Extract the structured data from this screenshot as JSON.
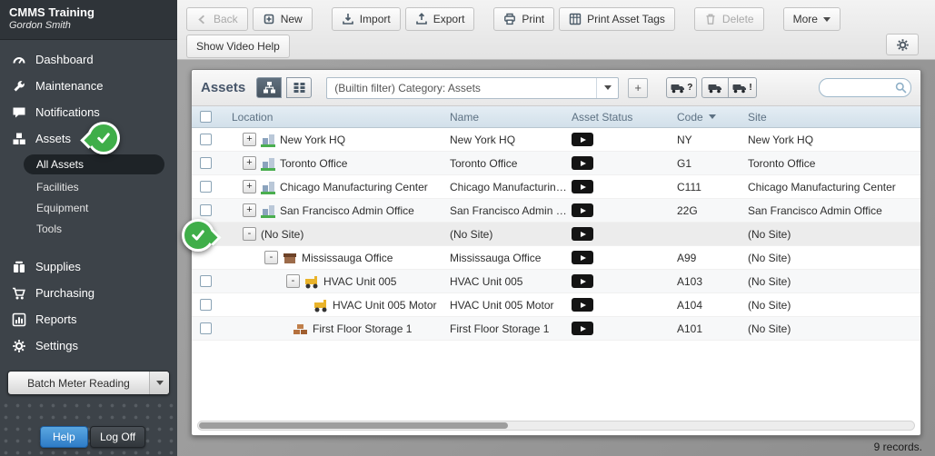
{
  "colors": {
    "accent_green": "#3fae49",
    "sidebar_bg": "#3d4349",
    "table_header_bg": "#d8e3ed",
    "help_button_blue": "#2e7cc7",
    "status_chip_black": "#141414"
  },
  "icons": {
    "sidebar": [
      "gauge-icon",
      "wrench-icon",
      "speech-bubble-icon",
      "boxes-icon",
      "supplies-icon",
      "cart-icon",
      "chart-icon",
      "gear-icon"
    ],
    "search": "magnifier",
    "asset_status": "video-play-button",
    "annotations": "green-check-badge"
  },
  "sidebar": {
    "title": "CMMS Training",
    "subtitle": "Gordon Smith",
    "items": [
      {
        "label": "Dashboard"
      },
      {
        "label": "Maintenance"
      },
      {
        "label": "Notifications"
      },
      {
        "label": "Assets"
      },
      {
        "label": "Supplies"
      },
      {
        "label": "Purchasing"
      },
      {
        "label": "Reports"
      },
      {
        "label": "Settings"
      }
    ],
    "assets_submenu": [
      {
        "label": "All Assets",
        "selected": true
      },
      {
        "label": "Facilities",
        "selected": false
      },
      {
        "label": "Equipment",
        "selected": false
      },
      {
        "label": "Tools",
        "selected": false
      }
    ],
    "batch_meter_button": "Batch Meter Reading",
    "help_button": "Help",
    "logoff_button": "Log Off"
  },
  "toolbar": {
    "back": "Back",
    "new": "New",
    "import": "Import",
    "export": "Export",
    "print": "Print",
    "print_asset_tags": "Print Asset Tags",
    "delete": "Delete",
    "more": "More",
    "show_video_help": "Show Video Help"
  },
  "panel": {
    "title": "Assets",
    "filter_value": "(Builtin filter) Category: Assets",
    "add_filter_label": "+",
    "truck_help_label": "?",
    "truck_alert_label": "!",
    "records_count": "9 records."
  },
  "table": {
    "columns": {
      "location": "Location",
      "name": "Name",
      "asset_status": "Asset Status",
      "code": "Code",
      "site": "Site"
    },
    "rows": [
      {
        "expander": "+",
        "icon": "site-icon",
        "location": "New York HQ",
        "name": "New York HQ",
        "code": "NY",
        "site": "New York HQ"
      },
      {
        "expander": "+",
        "icon": "site-icon",
        "location": "Toronto Office",
        "name": "Toronto Office",
        "code": "G1",
        "site": "Toronto Office"
      },
      {
        "expander": "+",
        "icon": "site-icon",
        "location": "Chicago Manufacturing Center",
        "name": "Chicago Manufacturing...",
        "code": "C111",
        "site": "Chicago Manufacturing Center"
      },
      {
        "expander": "+",
        "icon": "site-icon",
        "location": "San Francisco Admin Office",
        "name": "San Francisco Admin O...",
        "code": "22G",
        "site": "San Francisco Admin Office"
      },
      {
        "expander": "-",
        "icon": "none",
        "location": "(No Site)",
        "name": "(No Site)",
        "code": "",
        "site": "(No Site)"
      },
      {
        "expander": "-",
        "icon": "facility-icon",
        "location": "Mississauga Office",
        "name": "Mississauga Office",
        "code": "A99",
        "site": "(No Site)"
      },
      {
        "expander": "-",
        "icon": "equipment-icon",
        "location": "HVAC Unit 005",
        "name": "HVAC Unit 005",
        "code": "A103",
        "site": "(No Site)"
      },
      {
        "expander": "",
        "icon": "equipment-icon",
        "location": "HVAC Unit 005 Motor",
        "name": "HVAC Unit 005 Motor",
        "code": "A104",
        "site": "(No Site)"
      },
      {
        "expander": "",
        "icon": "storage-icon",
        "location": "First Floor Storage 1",
        "name": "First Floor Storage 1",
        "code": "A101",
        "site": "(No Site)"
      }
    ]
  }
}
